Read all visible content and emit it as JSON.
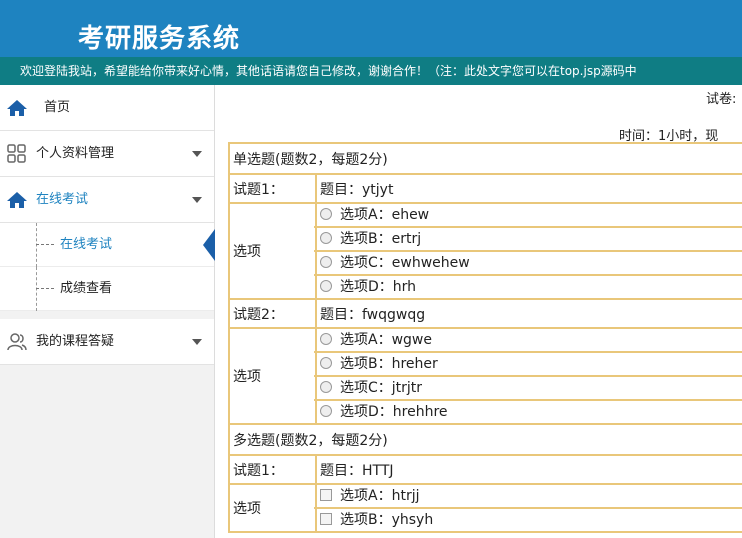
{
  "header": {
    "title": "考研服务系统",
    "notice": "欢迎登陆我站，希望能给你带来好心情，其他话语请您自己修改，谢谢合作！（注：此处文字您可以在top.jsp源码中"
  },
  "sidebar": {
    "items": [
      {
        "label": "首页",
        "icon": "home-icon"
      },
      {
        "label": "个人资料管理",
        "icon": "grid-icon"
      },
      {
        "label": "在线考试",
        "icon": "home-icon"
      },
      {
        "label": "我的课程答疑",
        "icon": "user-icon"
      }
    ],
    "sub_items": [
      {
        "label": "在线考试"
      },
      {
        "label": "成绩查看"
      }
    ]
  },
  "main": {
    "exam_name": "试卷:",
    "timer": "时间：1小时，现",
    "single_section": "单选题(题数2，每题2分)",
    "multi_section": "多选题(题数2，每题2分)",
    "options_label": "选项",
    "single": [
      {
        "no": "试题1：",
        "title": "题目：ytjyt",
        "options": [
          "选项A：ehew",
          "选项B：ertrj",
          "选项C：ewhwehew",
          "选项D：hrh"
        ]
      },
      {
        "no": "试题2：",
        "title": "题目：fwqgwqg",
        "options": [
          "选项A：wgwe",
          "选项B：hreher",
          "选项C：jtrjtr",
          "选项D：hrehhre"
        ]
      }
    ],
    "multi": [
      {
        "no": "试题1：",
        "title": "题目：HTTJ",
        "options": [
          "选项A：htrjj",
          "选项B：yhsyh"
        ]
      }
    ]
  },
  "colors": {
    "header_bg": "#1e83c0",
    "notice_bg": "#0f7d84",
    "table_border": "#e9c77a",
    "active": "#1e83c0"
  }
}
